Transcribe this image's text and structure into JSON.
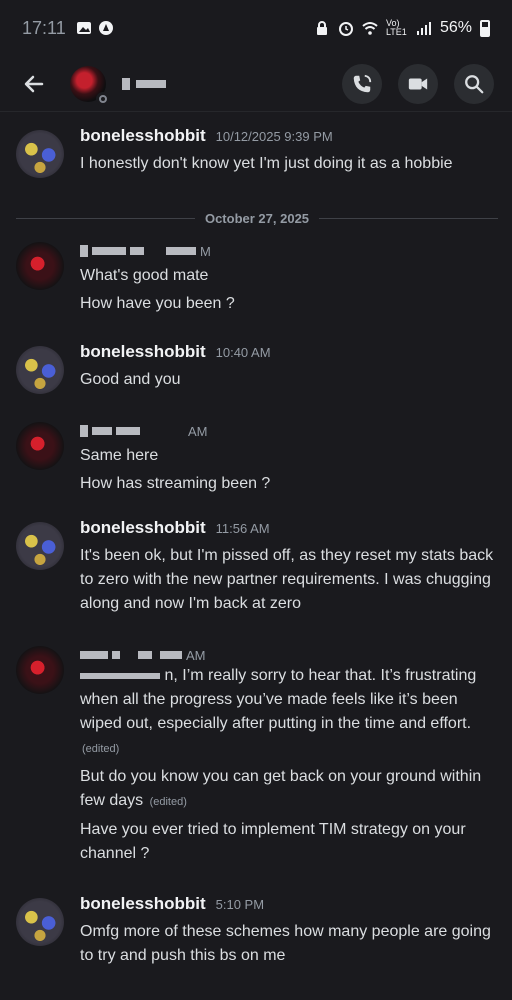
{
  "status_bar": {
    "time": "17:11",
    "network": "Vo) LTE1",
    "battery": "56%"
  },
  "header": {
    "icons": [
      "back-arrow-icon",
      "voice-call-icon",
      "video-call-icon",
      "search-icon"
    ]
  },
  "date_divider": "October 27, 2025",
  "messages": [
    {
      "author": "bonelesshobbit",
      "time": "10/12/2025 9:39 PM",
      "lines": [
        "I honestly don't know yet I'm just doing it as a hobbie"
      ]
    },
    {
      "author": "",
      "time": "M",
      "lines": [
        "What's good mate",
        "How have you been ?"
      ]
    },
    {
      "author": "bonelesshobbit",
      "time": "10:40 AM",
      "lines": [
        "Good and you"
      ]
    },
    {
      "author": "",
      "time": "AM",
      "lines": [
        "Same here",
        "How has streaming been ?"
      ]
    },
    {
      "author": "bonelesshobbit",
      "time": "11:56 AM",
      "lines": [
        "It's been ok, but I'm pissed off, as they reset my stats back to zero with the new partner requirements. I was chugging along and now I'm back at zero"
      ]
    },
    {
      "author": "",
      "time": "AM",
      "lines": [
        "n, I’m really sorry to hear that. It’s frustrating when all the progress you’ve made feels like it’s been wiped out, especially after putting in the time and effort.",
        "But do you know you can get back on your ground within few days",
        "Have you ever tried to implement TIM strategy on your channel ?"
      ],
      "edited_label": "(edited)"
    },
    {
      "author": "bonelesshobbit",
      "time": "5:10 PM",
      "lines": [
        "Omfg more of these schemes how many people are going to try and push this bs on me"
      ]
    }
  ]
}
